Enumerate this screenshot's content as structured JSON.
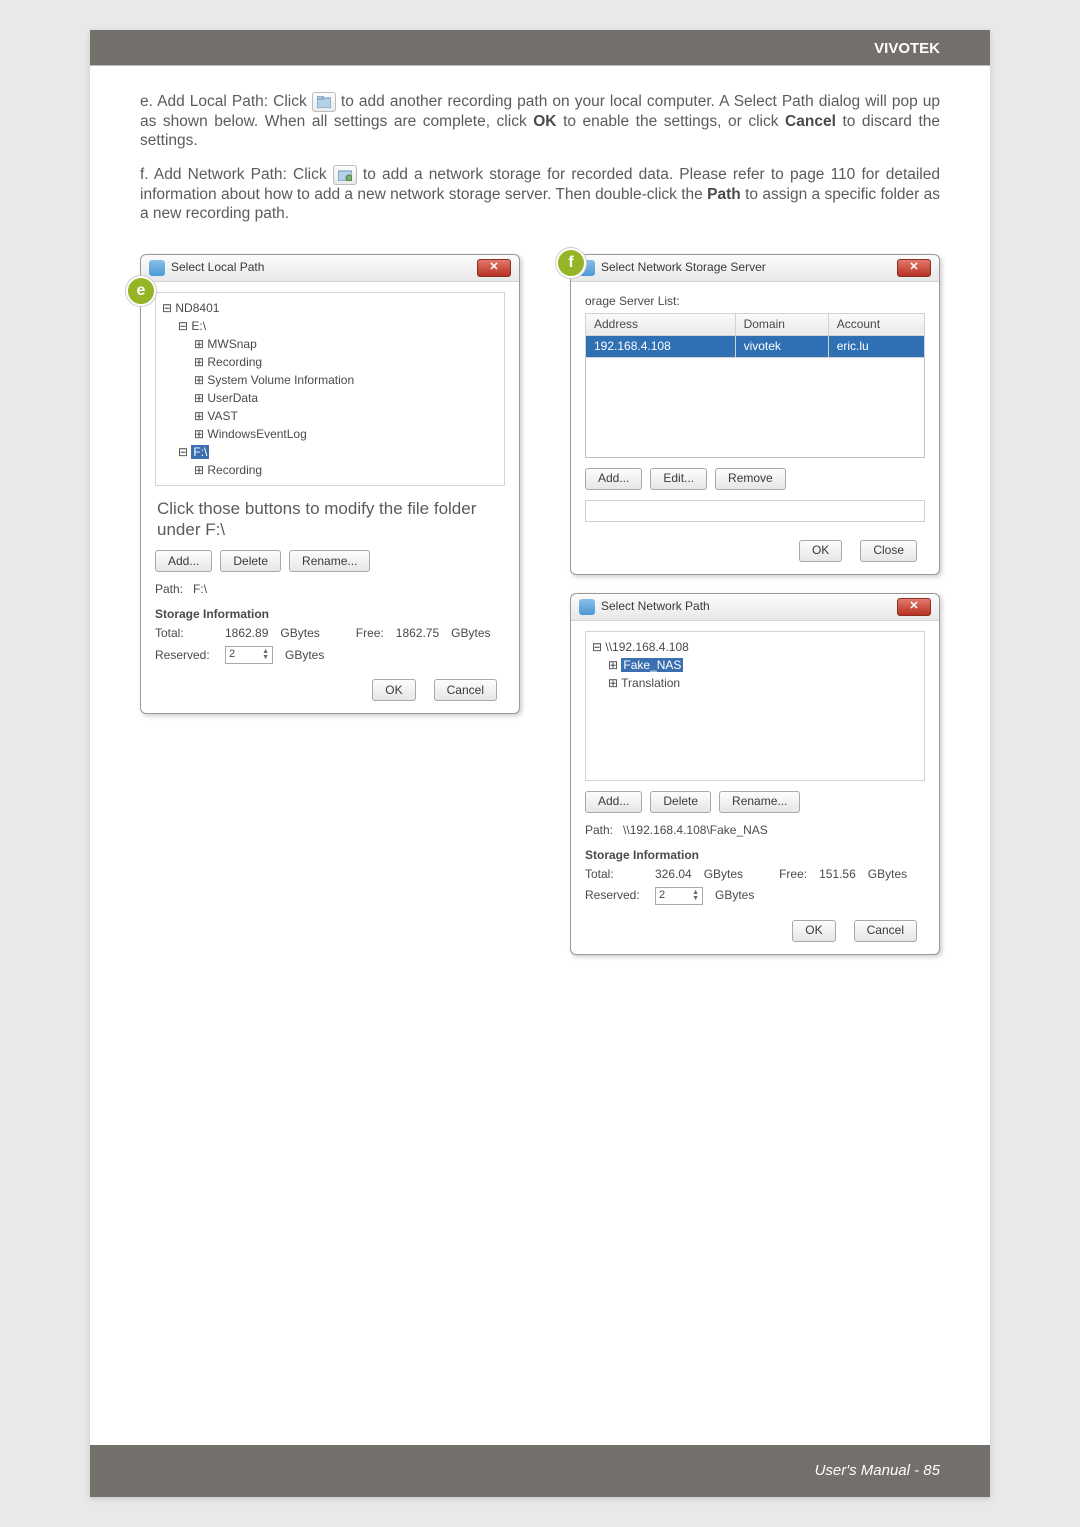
{
  "header": {
    "brand": "VIVOTEK"
  },
  "paragraphs": {
    "e_prefix": "e. Add Local Path: Click ",
    "e_rest": " to add another recording path on your local computer. A Select Path dialog will pop up as shown below. When all settings are complete, click ",
    "e_ok": "OK",
    "e_after_ok": " to enable the settings, or click ",
    "e_cancel": "Cancel",
    "e_tail": " to discard the settings.",
    "f_prefix": "f. Add Network Path: Click ",
    "f_rest": " to add a network storage for recorded data. Please refer to page 110 for detailed information about how to add a new network storage server. Then double-click the ",
    "f_path": "Path",
    "f_tail": " to assign a specific folder as a new recording path."
  },
  "balloons": {
    "e": "e",
    "f": "f"
  },
  "local_dialog": {
    "title": "Select Local Path",
    "tree": {
      "root": "ND8401",
      "drive_e": "E:\\",
      "e_children": [
        "MWSnap",
        "Recording",
        "System Volume Information",
        "UserData",
        "VAST",
        "WindowsEventLog"
      ],
      "drive_f": "F:\\",
      "f_children": [
        "Recording"
      ]
    },
    "caption": "Click those buttons to modify the file folder under F:\\",
    "buttons": {
      "add": "Add...",
      "delete": "Delete",
      "rename": "Rename..."
    },
    "path_label": "Path:",
    "path_value": "F:\\",
    "storage_title": "Storage Information",
    "total_label": "Total:",
    "total_value": "1862.89",
    "unit": "GBytes",
    "free_label": "Free:",
    "free_value": "1862.75",
    "reserved_label": "Reserved:",
    "reserved_value": "2",
    "ok": "OK",
    "cancel": "Cancel"
  },
  "server_dialog": {
    "title": "Select Network Storage Server",
    "list_label": "orage Server List:",
    "columns": {
      "addr": "Address",
      "domain": "Domain",
      "account": "Account"
    },
    "row": {
      "addr": "192.168.4.108",
      "domain": "vivotek",
      "account": "eric.lu"
    },
    "buttons": {
      "add": "Add...",
      "edit": "Edit...",
      "remove": "Remove",
      "ok": "OK",
      "close": "Close"
    }
  },
  "netpath_dialog": {
    "title": "Select Network Path",
    "tree": {
      "root": "\\\\192.168.4.108",
      "sel": "Fake_NAS",
      "other": "Translation"
    },
    "buttons": {
      "add": "Add...",
      "delete": "Delete",
      "rename": "Rename..."
    },
    "path_label": "Path:",
    "path_value": "\\\\192.168.4.108\\Fake_NAS",
    "storage_title": "Storage Information",
    "total_label": "Total:",
    "total_value": "326.04",
    "unit": "GBytes",
    "free_label": "Free:",
    "free_value": "151.56",
    "reserved_label": "Reserved:",
    "reserved_value": "2",
    "ok": "OK",
    "cancel": "Cancel"
  },
  "footerText": "User's Manual - 85"
}
